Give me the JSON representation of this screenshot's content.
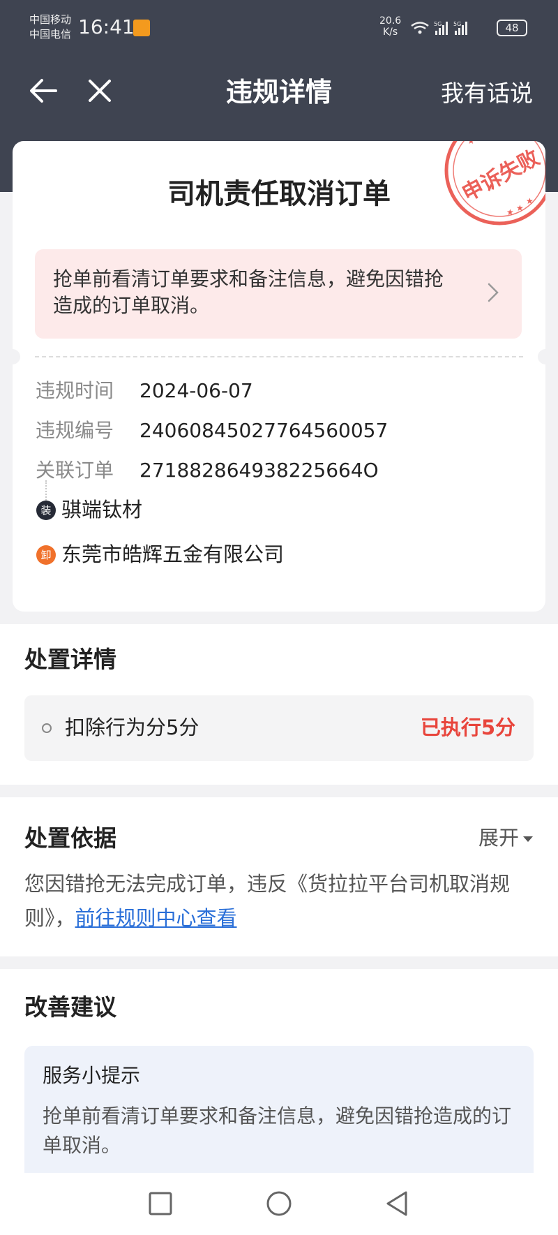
{
  "status_bar": {
    "carrier_1": "中国移动",
    "carrier_2": "中国电信",
    "time": "16:41",
    "net_speed_value": "20.6",
    "net_speed_unit": "K/s",
    "signal_1": "5G",
    "signal_2": "5G",
    "battery": "48",
    "icons": [
      "notification-app-icon",
      "wifi-icon",
      "signal-icon",
      "signal-icon",
      "battery-icon"
    ]
  },
  "nav": {
    "title": "违规详情",
    "action": "我有话说",
    "back_icon": "arrow-left-icon",
    "close_icon": "close-icon"
  },
  "violation": {
    "title": "司机责任取消订单",
    "stamp_text": "申诉失败",
    "notice": "抢单前看清订单要求和备注信息，避免因错抢造成的订单取消。",
    "fields": [
      {
        "label": "违规时间",
        "value": "2024-06-07"
      },
      {
        "label": "违规编号",
        "value": "24060845027764560057"
      },
      {
        "label": "关联订单",
        "value": "271882864938225664O"
      }
    ],
    "route": [
      {
        "badge": "装",
        "name": "骐端钛材",
        "color": "#262a36"
      },
      {
        "badge": "卸",
        "name": "东莞市皓辉五金有限公司",
        "color": "#f0712b"
      }
    ]
  },
  "disposal": {
    "title": "处置详情",
    "item_label": "扣除行为分5分",
    "item_status": "已执行5分",
    "status_color": "#e8453c"
  },
  "basis": {
    "title": "处置依据",
    "expand_label": "展开",
    "text": "您因错抢无法完成订单，违反《货拉拉平台司机取消规则》，",
    "link": "前往规则中心查看",
    "link_color": "#2a6fd8"
  },
  "suggestion": {
    "title": "改善建议",
    "tip_title": "服务小提示",
    "tip_text": " 抢单前看清订单要求和备注信息，避免因错抢造成的订单取消。"
  },
  "system_nav": {
    "icons": [
      "recent-apps-icon",
      "home-icon",
      "back-icon"
    ]
  },
  "colors": {
    "header_bg": "#3f4451",
    "stamp_red": "#e8453c",
    "notice_bg": "#fdeaea"
  }
}
